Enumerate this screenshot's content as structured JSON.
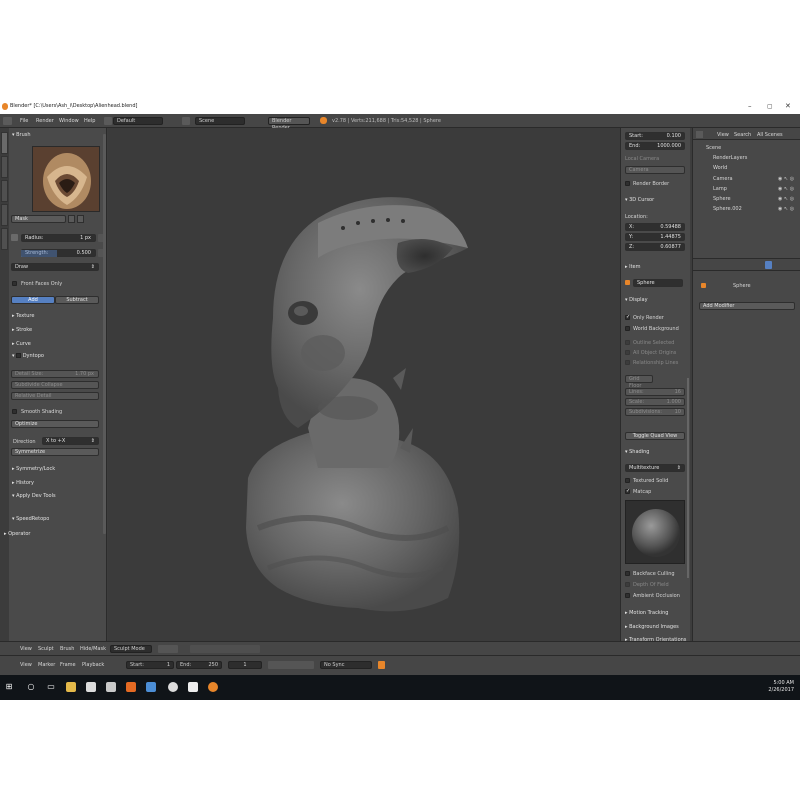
{
  "window": {
    "title": "Blender* [C:\\Users\\Ash_i\\Desktop\\Alienhead.blend]"
  },
  "info_header": {
    "menus": [
      "File",
      "Render",
      "Window",
      "Help"
    ],
    "layout": "Default",
    "scene": "Scene",
    "engine": "Blender Render",
    "stats": "v2.78 | Verts:211,688 | Tris:54,528 | Sphere"
  },
  "tool_shelf": {
    "tabs": [
      "Tools",
      "Options",
      "Grease Pencil",
      "Create",
      "Relations"
    ],
    "brush_header": "Brush",
    "brush_name": "Mask",
    "radius_label": "Radius:",
    "radius_value": "1 px",
    "strength_label": "Strength:",
    "strength_value": "0.500",
    "draw_mode": "Draw",
    "front_faces_only": "Front Faces Only",
    "add_label": "Add",
    "subtract_label": "Subtract",
    "sections": [
      "Texture",
      "Stroke",
      "Curve"
    ],
    "dyntopo_label": "Dyntopo",
    "detail_size_label": "Detail Size:",
    "detail_size_value": "1.70 px",
    "subdivide_collapse": "Subdivide Collapse",
    "relative_detail": "Relative Detail",
    "smooth_shading": "Smooth Shading",
    "optimize": "Optimize",
    "direction_label": "Direction",
    "direction_value": "X to +X",
    "symmetrize": "Symmetrize",
    "sections_after": [
      "Symmetry/Lock",
      "History",
      "Apply Dev Tools"
    ],
    "speed_retopo": "SpeedRetopo",
    "operator": "Operator"
  },
  "n_panel": {
    "start_label": "Start:",
    "start_value": "0.100",
    "end_label": "End:",
    "end_value": "1000.000",
    "local_camera": "Local Camera",
    "camera": "Camera",
    "render_border": "Render Border",
    "cursor_header": "3D Cursor",
    "location_label": "Location:",
    "x_label": "X:",
    "x_value": "0.59488",
    "y_label": "Y:",
    "y_value": "1.44875",
    "z_label": "Z:",
    "z_value": "0.60877",
    "item_header": "Item",
    "item_name": "Sphere",
    "display_header": "Display",
    "only_render": "Only Render",
    "world_background": "World Background",
    "outline_selected": "Outline Selected",
    "all_object_origins": "All Object Origins",
    "relationship_lines": "Relationship Lines",
    "grid_floor": "Grid Floor",
    "lines_label": "Lines:",
    "lines_value": "16",
    "scale_label": "Scale:",
    "scale_value": "1.000",
    "subdivisions_label": "Subdivisions:",
    "subdivisions_value": "10",
    "toggle_quad_view": "Toggle Quad View",
    "shading_header": "Shading",
    "shading_mode": "Multitexture",
    "textured_solid": "Textured Solid",
    "matcap": "Matcap",
    "backface_culling": "Backface Culling",
    "depth_of_field": "Depth Of Field",
    "ambient_occlusion": "Ambient Occlusion",
    "motion_tracking": "Motion Tracking",
    "background_images": "Background Images",
    "transform_orientations": "Transform Orientations"
  },
  "outliner": {
    "tabs": [
      "View",
      "Search",
      "All Scenes"
    ],
    "items": [
      "Scene",
      "RenderLayers",
      "World",
      "Camera",
      "Lamp",
      "Sphere",
      "Sphere.002"
    ]
  },
  "properties": {
    "object_name": "Sphere",
    "add_modifier": "Add Modifier"
  },
  "view_header": {
    "menus": [
      "View",
      "Sculpt",
      "Brush",
      "Hide/Mask"
    ],
    "mode": "Sculpt Mode"
  },
  "timeline": {
    "menus": [
      "View",
      "Marker",
      "Frame",
      "Playback"
    ],
    "start_label": "Start:",
    "start_value": "1",
    "end_label": "End:",
    "end_value": "250",
    "current_frame": "1",
    "sync": "No Sync"
  },
  "taskbar": {
    "time": "5:00 AM",
    "date": "2/26/2017"
  },
  "colors": {
    "accent_blue": "#5680c2",
    "orange": "#e8862a"
  }
}
